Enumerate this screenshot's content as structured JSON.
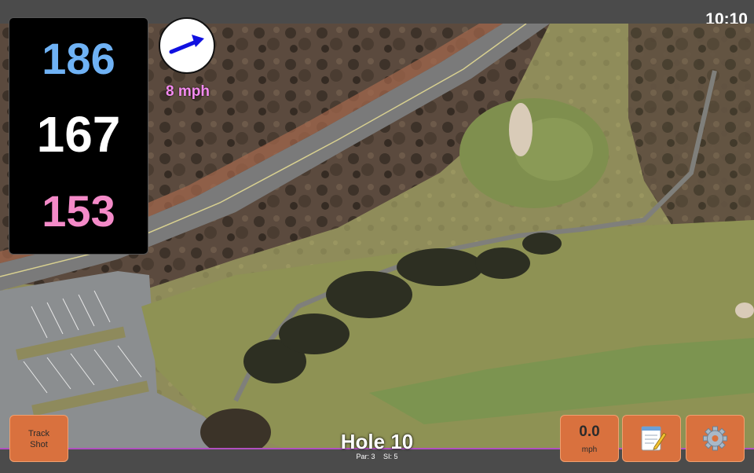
{
  "status": {
    "time": "10:10"
  },
  "distances": {
    "back": "186",
    "middle": "167",
    "front": "153"
  },
  "wind": {
    "speed_label": "8 mph",
    "arrow_color": "#1010e0"
  },
  "buttons": {
    "track_shot_line1": "Track",
    "track_shot_line2": "Shot",
    "speed_value": "0.0",
    "speed_unit": "mph",
    "notes_icon": "notepad-icon",
    "settings_icon": "gear-icon"
  },
  "hole": {
    "title": "Hole 10",
    "par": "Par: 3",
    "si": "SI: 5"
  },
  "colors": {
    "accent_border": "#b050c0",
    "button_bg": "#d9713e",
    "back_distance": "#6fb2f5",
    "front_distance": "#f48ac8"
  }
}
